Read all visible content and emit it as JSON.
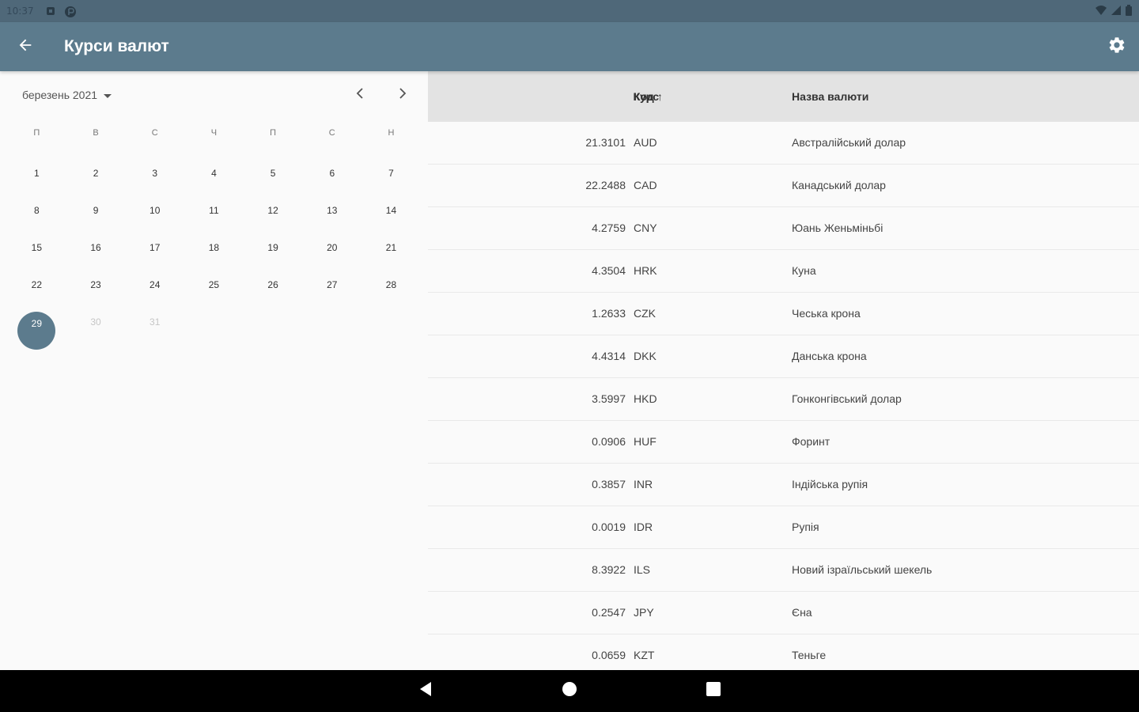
{
  "status_bar": {
    "time": "10:37",
    "icons": [
      "notification-icon",
      "app-icon",
      "wifi-icon",
      "signal-icon",
      "battery-icon"
    ]
  },
  "app_bar": {
    "title": "Курси валют",
    "icons": [
      "arrow-back-icon",
      "settings-gear-icon"
    ]
  },
  "calendar": {
    "month_label": "березень 2021",
    "weekdays": [
      "П",
      "В",
      "С",
      "Ч",
      "П",
      "С",
      "Н"
    ],
    "days": [
      {
        "label": "1"
      },
      {
        "label": "2"
      },
      {
        "label": "3"
      },
      {
        "label": "4"
      },
      {
        "label": "5"
      },
      {
        "label": "6"
      },
      {
        "label": "7"
      },
      {
        "label": "8"
      },
      {
        "label": "9"
      },
      {
        "label": "10"
      },
      {
        "label": "11"
      },
      {
        "label": "12"
      },
      {
        "label": "13"
      },
      {
        "label": "14"
      },
      {
        "label": "15"
      },
      {
        "label": "16"
      },
      {
        "label": "17"
      },
      {
        "label": "18"
      },
      {
        "label": "19"
      },
      {
        "label": "20"
      },
      {
        "label": "21"
      },
      {
        "label": "22"
      },
      {
        "label": "23"
      },
      {
        "label": "24"
      },
      {
        "label": "25"
      },
      {
        "label": "26"
      },
      {
        "label": "27"
      },
      {
        "label": "28"
      },
      {
        "label": "29",
        "state": "selected"
      },
      {
        "label": "30",
        "state": "muted"
      },
      {
        "label": "31",
        "state": "muted"
      }
    ],
    "selected_color": "#5c7b8d"
  },
  "table": {
    "headers": {
      "rate": "Курс",
      "code": "Код",
      "name": "Назва валюти"
    },
    "sort_indicator": "↑",
    "rows": [
      {
        "rate": "21.3101",
        "code": "AUD",
        "name": "Австралійський долар"
      },
      {
        "rate": "22.2488",
        "code": "CAD",
        "name": "Канадський долар"
      },
      {
        "rate": "4.2759",
        "code": "CNY",
        "name": "Юань Женьміньбі"
      },
      {
        "rate": "4.3504",
        "code": "HRK",
        "name": "Куна"
      },
      {
        "rate": "1.2633",
        "code": "CZK",
        "name": "Чеська крона"
      },
      {
        "rate": "4.4314",
        "code": "DKK",
        "name": "Данська крона"
      },
      {
        "rate": "3.5997",
        "code": "HKD",
        "name": "Гонконгівський долар"
      },
      {
        "rate": "0.0906",
        "code": "HUF",
        "name": "Форинт"
      },
      {
        "rate": "0.3857",
        "code": "INR",
        "name": "Індійська рупія"
      },
      {
        "rate": "0.0019",
        "code": "IDR",
        "name": "Рупія"
      },
      {
        "rate": "8.3922",
        "code": "ILS",
        "name": "Новий ізраїльський шекель"
      },
      {
        "rate": "0.2547",
        "code": "JPY",
        "name": "Єна"
      },
      {
        "rate": "0.0659",
        "code": "KZT",
        "name": "Теньге"
      }
    ]
  },
  "colors": {
    "status_bar": "#4f6879",
    "app_bar": "#5c7b8d",
    "table_header": "#e3e3e3",
    "background": "#fafafa"
  },
  "nav_bar": {
    "icons": [
      "nav-back-icon",
      "nav-home-icon",
      "nav-recents-icon"
    ]
  }
}
